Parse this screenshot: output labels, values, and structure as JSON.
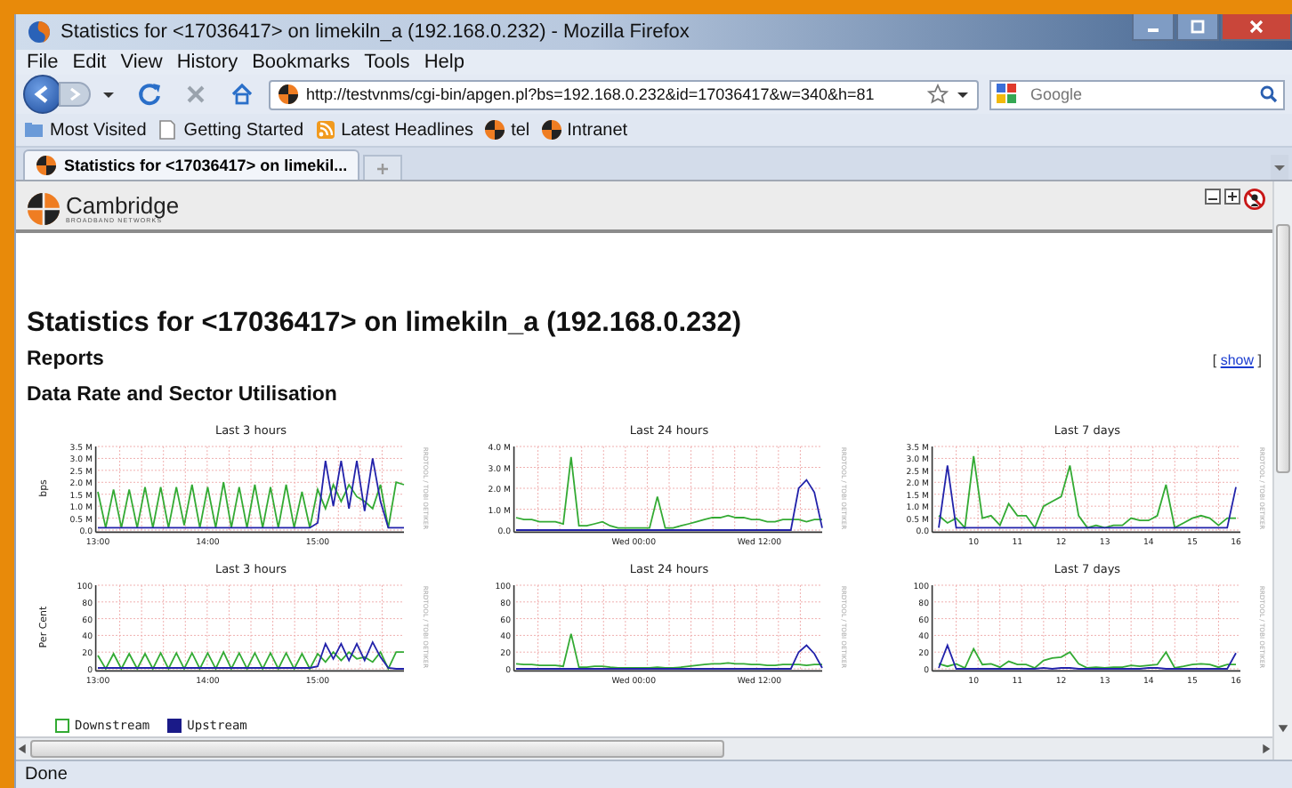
{
  "window": {
    "title": "Statistics for <17036417> on limekiln_a (192.168.0.232) - Mozilla Firefox"
  },
  "menu": [
    "File",
    "Edit",
    "View",
    "History",
    "Bookmarks",
    "Tools",
    "Help"
  ],
  "address_bar": {
    "value": "http://testvnms/cgi-bin/apgen.pl?bs=192.168.0.232&id=17036417&w=340&h=81"
  },
  "search": {
    "placeholder": "Google"
  },
  "bookmarks": [
    {
      "label": "Most Visited",
      "kind": "smart"
    },
    {
      "label": "Getting Started",
      "kind": "page"
    },
    {
      "label": "Latest Headlines",
      "kind": "feed"
    },
    {
      "label": "tel",
      "kind": "site"
    },
    {
      "label": "Intranet",
      "kind": "site"
    }
  ],
  "tabs": [
    {
      "label": "Statistics for <17036417> on limekil...",
      "selected": true
    }
  ],
  "page": {
    "logo": {
      "name": "Cambridge",
      "tagline": "BROADBAND NETWORKS"
    },
    "heading": "Statistics for <17036417> on limekiln_a (192.168.0.232)",
    "reports": {
      "title": "Reports",
      "before": "[",
      "toggle": "show",
      "after": "]"
    },
    "section_title": "Data Rate and Sector Utilisation",
    "charts": [
      {
        "chart_data": {
          "type": "line",
          "title": "Last 3 hours",
          "ylabel": "bps",
          "grid": true,
          "categories": [
            "13:00",
            null,
            null,
            null,
            null,
            null,
            null,
            null,
            null,
            null,
            null,
            null,
            null,
            null,
            "14:00",
            null,
            null,
            null,
            null,
            null,
            null,
            null,
            null,
            null,
            null,
            null,
            null,
            null,
            "15:00",
            null,
            null,
            null,
            null,
            null,
            null,
            null,
            null,
            null,
            null,
            null
          ],
          "ylim": [
            0,
            3.5
          ],
          "yticks": [
            {
              "value": 0,
              "label": "0.0"
            },
            {
              "value": 0.5,
              "label": "0.5 M"
            },
            {
              "value": 1,
              "label": "1.0 M"
            },
            {
              "value": 1.5,
              "label": "1.5 M"
            },
            {
              "value": 2,
              "label": "2.0 M"
            },
            {
              "value": 2.5,
              "label": "2.5 M"
            },
            {
              "value": 3,
              "label": "3.0 M"
            },
            {
              "value": 3.5,
              "label": "3.5 M"
            }
          ],
          "series": [
            {
              "color": "#33aa33",
              "values": [
                1.6,
                0.1,
                1.7,
                0.1,
                1.7,
                0.1,
                1.8,
                0.1,
                1.8,
                0.1,
                1.8,
                0.2,
                1.9,
                0.1,
                1.8,
                0.1,
                2.0,
                0.1,
                1.8,
                0.1,
                1.9,
                0.1,
                1.8,
                0.1,
                1.9,
                0.1,
                1.6,
                0.1,
                1.7,
                0.9,
                1.9,
                1.2,
                1.9,
                1.4,
                1.2,
                0.9,
                1.9,
                0.1,
                2.0,
                1.9
              ]
            },
            {
              "color": "#2222aa",
              "values": [
                0.1,
                0.1,
                0.1,
                0.1,
                0.1,
                0.1,
                0.1,
                0.1,
                0.1,
                0.1,
                0.1,
                0.1,
                0.1,
                0.1,
                0.1,
                0.1,
                0.1,
                0.1,
                0.1,
                0.1,
                0.1,
                0.1,
                0.1,
                0.1,
                0.1,
                0.1,
                0.1,
                0.1,
                0.3,
                2.9,
                1.0,
                2.9,
                0.9,
                2.9,
                0.8,
                3.0,
                1.2,
                0.1,
                0.1,
                0.1
              ]
            }
          ]
        },
        "watermark": "RRDTOOL / TOBI OETIKER"
      },
      {
        "chart_data": {
          "type": "line",
          "title": "Last 24 hours",
          "grid": true,
          "categories": [
            null,
            null,
            null,
            null,
            null,
            null,
            null,
            null,
            null,
            null,
            null,
            null,
            null,
            null,
            null,
            "Wed 00:00",
            null,
            null,
            null,
            null,
            null,
            null,
            null,
            null,
            null,
            null,
            null,
            null,
            null,
            null,
            null,
            "Wed 12:00",
            null,
            null,
            null,
            null,
            null,
            null,
            null,
            null
          ],
          "ylim": [
            0,
            4
          ],
          "yticks": [
            {
              "value": 0,
              "label": "0.0"
            },
            {
              "value": 1,
              "label": "1.0 M"
            },
            {
              "value": 2,
              "label": "2.0 M"
            },
            {
              "value": 3,
              "label": "3.0 M"
            },
            {
              "value": 4,
              "label": "4.0 M"
            }
          ],
          "series": [
            {
              "color": "#33aa33",
              "values": [
                0.6,
                0.5,
                0.5,
                0.4,
                0.4,
                0.4,
                0.3,
                3.5,
                0.2,
                0.2,
                0.3,
                0.4,
                0.2,
                0.1,
                0.1,
                0.1,
                0.1,
                0.1,
                1.6,
                0.1,
                0.1,
                0.2,
                0.3,
                0.4,
                0.5,
                0.6,
                0.6,
                0.7,
                0.6,
                0.6,
                0.5,
                0.5,
                0.4,
                0.4,
                0.5,
                0.5,
                0.5,
                0.4,
                0.5,
                0.5
              ]
            },
            {
              "color": "#2222aa",
              "values": [
                0,
                0,
                0,
                0,
                0,
                0,
                0,
                0,
                0,
                0,
                0,
                0,
                0,
                0,
                0,
                0,
                0,
                0,
                0,
                0,
                0,
                0,
                0,
                0,
                0,
                0,
                0,
                0,
                0,
                0,
                0,
                0,
                0,
                0,
                0,
                0,
                2.0,
                2.4,
                1.8,
                0.1
              ]
            }
          ]
        },
        "watermark": "RRDTOOL / TOBI OETIKER"
      },
      {
        "chart_data": {
          "type": "line",
          "title": "Last 7 days",
          "grid": true,
          "x": [
            9.2,
            9.4,
            9.6,
            9.8,
            10.0,
            10.2,
            10.4,
            10.6,
            10.8,
            11.0,
            11.2,
            11.4,
            11.6,
            11.8,
            12.0,
            12.2,
            12.4,
            12.6,
            12.8,
            13.0,
            13.2,
            13.4,
            13.6,
            13.8,
            14.0,
            14.2,
            14.4,
            14.6,
            14.8,
            15.0,
            15.2,
            15.4,
            15.6,
            15.8,
            16.0
          ],
          "xlim": [
            9.1,
            16.1
          ],
          "ylim": [
            0,
            3.5
          ],
          "xticks": [
            10,
            11,
            12,
            13,
            14,
            15,
            16
          ],
          "yticks": [
            {
              "value": 0,
              "label": "0.0"
            },
            {
              "value": 0.5,
              "label": "0.5 M"
            },
            {
              "value": 1,
              "label": "1.0 M"
            },
            {
              "value": 1.5,
              "label": "1.5 M"
            },
            {
              "value": 2,
              "label": "2.0 M"
            },
            {
              "value": 2.5,
              "label": "2.5 M"
            },
            {
              "value": 3,
              "label": "3.0 M"
            },
            {
              "value": 3.5,
              "label": "3.5 M"
            }
          ],
          "series": [
            {
              "color": "#33aa33",
              "values": [
                0.6,
                0.3,
                0.5,
                0.1,
                3.1,
                0.5,
                0.6,
                0.2,
                1.1,
                0.6,
                0.6,
                0.1,
                1.0,
                1.2,
                1.4,
                2.7,
                0.6,
                0.1,
                0.2,
                0.1,
                0.2,
                0.2,
                0.5,
                0.4,
                0.4,
                0.6,
                1.9,
                0.1,
                0.3,
                0.5,
                0.6,
                0.5,
                0.2,
                0.5,
                0.5
              ]
            },
            {
              "color": "#2222aa",
              "values": [
                0.1,
                2.7,
                0.1,
                0.1,
                0.1,
                0.1,
                0.1,
                0.1,
                0.1,
                0.1,
                0.1,
                0.1,
                0.1,
                0.1,
                0.1,
                0.1,
                0.1,
                0.1,
                0.1,
                0.1,
                0.1,
                0.1,
                0.1,
                0.1,
                0.1,
                0.1,
                0.1,
                0.1,
                0.1,
                0.1,
                0.1,
                0.1,
                0.1,
                0.1,
                1.8
              ]
            }
          ]
        },
        "watermark": "RRDTOOL / TOBI OETIKER"
      },
      {
        "chart_data": {
          "type": "line",
          "title": "Last 3 hours",
          "ylabel": "Per Cent",
          "grid": true,
          "categories": [
            "13:00",
            null,
            null,
            null,
            null,
            null,
            null,
            null,
            null,
            null,
            null,
            null,
            null,
            null,
            "14:00",
            null,
            null,
            null,
            null,
            null,
            null,
            null,
            null,
            null,
            null,
            null,
            null,
            null,
            "15:00",
            null,
            null,
            null,
            null,
            null,
            null,
            null,
            null,
            null,
            null,
            null
          ],
          "ylim": [
            0,
            100
          ],
          "yticks": [
            0,
            20,
            40,
            60,
            80,
            100
          ],
          "series": [
            {
              "color": "#33aa33",
              "values": [
                16,
                0,
                18,
                0,
                18,
                0,
                18,
                0,
                19,
                0,
                19,
                0,
                19,
                0,
                19,
                0,
                20,
                0,
                19,
                0,
                19,
                0,
                19,
                0,
                19,
                0,
                18,
                0,
                18,
                8,
                20,
                10,
                20,
                12,
                14,
                8,
                20,
                0,
                20,
                20
              ]
            },
            {
              "color": "#2222aa",
              "values": [
                1,
                1,
                1,
                1,
                1,
                1,
                1,
                1,
                1,
                1,
                1,
                1,
                1,
                1,
                1,
                1,
                1,
                1,
                1,
                1,
                1,
                1,
                1,
                1,
                1,
                1,
                1,
                1,
                3,
                30,
                12,
                30,
                10,
                30,
                10,
                32,
                14,
                1,
                0,
                0
              ]
            }
          ]
        },
        "watermark": "RRDTOOL / TOBI OETIKER"
      },
      {
        "chart_data": {
          "type": "line",
          "title": "Last 24 hours",
          "grid": true,
          "categories": [
            null,
            null,
            null,
            null,
            null,
            null,
            null,
            null,
            null,
            null,
            null,
            null,
            null,
            null,
            null,
            "Wed 00:00",
            null,
            null,
            null,
            null,
            null,
            null,
            null,
            null,
            null,
            null,
            null,
            null,
            null,
            null,
            null,
            "Wed 12:00",
            null,
            null,
            null,
            null,
            null,
            null,
            null,
            null
          ],
          "ylim": [
            0,
            100
          ],
          "yticks": [
            0,
            20,
            40,
            60,
            80,
            100
          ],
          "series": [
            {
              "color": "#33aa33",
              "values": [
                6,
                5,
                5,
                4,
                4,
                4,
                3,
                42,
                2,
                2,
                3,
                3,
                2,
                1,
                1,
                1,
                1,
                1,
                2,
                1,
                1,
                2,
                3,
                4,
                5,
                6,
                6,
                7,
                6,
                6,
                5,
                5,
                4,
                4,
                5,
                5,
                5,
                4,
                5,
                5
              ]
            },
            {
              "color": "#2222aa",
              "values": [
                0,
                0,
                0,
                0,
                0,
                0,
                0,
                0,
                0,
                0,
                0,
                0,
                0,
                0,
                0,
                0,
                0,
                0,
                0,
                0,
                0,
                0,
                0,
                0,
                0,
                0,
                0,
                0,
                0,
                0,
                0,
                0,
                0,
                0,
                0,
                0,
                20,
                28,
                18,
                1
              ]
            }
          ]
        },
        "watermark": "RRDTOOL / TOBI OETIKER"
      },
      {
        "chart_data": {
          "type": "line",
          "title": "Last 7 days",
          "grid": true,
          "x": [
            9.2,
            9.4,
            9.6,
            9.8,
            10.0,
            10.2,
            10.4,
            10.6,
            10.8,
            11.0,
            11.2,
            11.4,
            11.6,
            11.8,
            12.0,
            12.2,
            12.4,
            12.6,
            12.8,
            13.0,
            13.2,
            13.4,
            13.6,
            13.8,
            14.0,
            14.2,
            14.4,
            14.6,
            14.8,
            15.0,
            15.2,
            15.4,
            15.6,
            15.8,
            16.0
          ],
          "xlim": [
            9.1,
            16.1
          ],
          "ylim": [
            0,
            100
          ],
          "xticks": [
            10,
            11,
            12,
            13,
            14,
            15,
            16
          ],
          "yticks": [
            0,
            20,
            40,
            60,
            80,
            100
          ],
          "series": [
            {
              "color": "#33aa33",
              "values": [
                6,
                3,
                6,
                1,
                24,
                5,
                6,
                2,
                9,
                5,
                5,
                1,
                10,
                13,
                14,
                20,
                6,
                1,
                2,
                1,
                2,
                2,
                4,
                3,
                4,
                5,
                20,
                1,
                3,
                5,
                6,
                5,
                2,
                5,
                5
              ]
            },
            {
              "color": "#2222aa",
              "values": [
                1,
                28,
                0,
                0,
                0,
                0,
                0,
                0,
                0,
                0,
                0,
                0,
                1,
                0,
                1,
                1,
                0,
                0,
                0,
                0,
                0,
                0,
                0,
                0,
                1,
                1,
                0,
                0,
                0,
                0,
                0,
                0,
                0,
                0,
                19
              ]
            }
          ]
        },
        "watermark": "RRDTOOL / TOBI OETIKER"
      }
    ],
    "legend": [
      {
        "name": "Downstream",
        "color": "#33aa33",
        "kind": "hollow"
      },
      {
        "name": "Upstream",
        "color": "#1a1a88",
        "kind": "filled"
      }
    ]
  },
  "status_bar": {
    "text": "Done"
  }
}
